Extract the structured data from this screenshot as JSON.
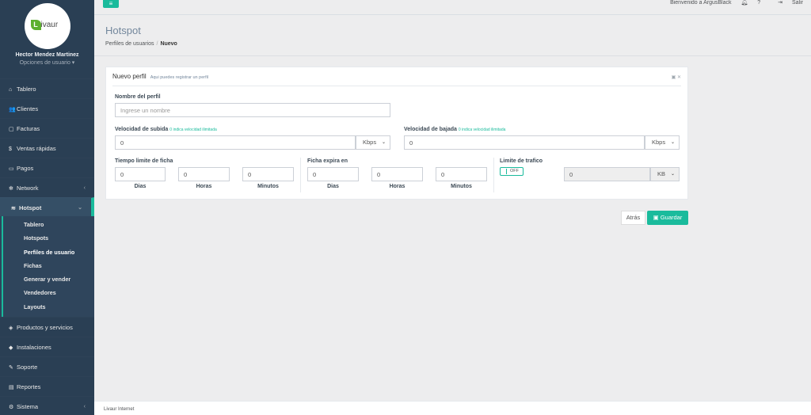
{
  "sidebar": {
    "user_name": "Hector Mendez Martinez",
    "user_options": "Opciones de usuario ▾",
    "logo_letter": "L",
    "logo_text": "ivaur",
    "menu": [
      {
        "label": "Tablero",
        "icon": "home-icon"
      },
      {
        "label": "Clientes",
        "icon": "users-icon"
      },
      {
        "label": "Facturas",
        "icon": "document-icon"
      },
      {
        "label": "Ventas rápidas",
        "icon": "dollar-icon"
      },
      {
        "label": "Pagos",
        "icon": "money-icon"
      },
      {
        "label": "Network",
        "icon": "gear-icon"
      },
      {
        "label": "Hotspot",
        "icon": "wifi-icon"
      },
      {
        "label": "Productos y servicios",
        "icon": "tags-icon"
      },
      {
        "label": "Instalaciones",
        "icon": "tag-icon"
      },
      {
        "label": "Soporte",
        "icon": "wrench-icon"
      },
      {
        "label": "Reportes",
        "icon": "database-icon"
      },
      {
        "label": "Sistema",
        "icon": "cogs-icon"
      }
    ],
    "hotspot_submenu": [
      "Tablero",
      "Hotspots",
      "Perfiles de usuario",
      "Fichas",
      "Generar y vender",
      "Vendedores",
      "Layouts"
    ]
  },
  "topbar": {
    "welcome": "Bienvenido a ArgusBlack",
    "logout": "Salir"
  },
  "page": {
    "title": "Hotspot",
    "breadcrumb_parent": "Perfiles de usuarios",
    "breadcrumb_current": "Nuevo"
  },
  "panel": {
    "title": "Nuevo perfil",
    "subtitle": "Aqui puedes registrar un perfil",
    "profile_name_label": "Nombre del perfil",
    "profile_name_placeholder": "Ingrese un nombre",
    "upload_label": "Velocidad de subida",
    "download_label": "Velocidad de bajada",
    "speed_hint": "0 indica velocidad ilimitada",
    "upload_value": "0",
    "download_value": "0",
    "speed_unit": "Kbps",
    "time_limit_label": "Tiempo limite de ficha",
    "expires_label": "Ficha expira en",
    "traffic_label": "Limite de trafico",
    "days": "Dias",
    "hours": "Horas",
    "minutes": "Minutos",
    "zero": "0",
    "toggle_state": "OFF",
    "traffic_value": "0",
    "traffic_unit": "KB"
  },
  "actions": {
    "back": "Atrás",
    "save": "Guardar"
  },
  "footer": {
    "text": "Livaur Internet"
  },
  "colors": {
    "sidebar": "#2a3f54",
    "accent": "#1abb9c",
    "background": "#ededee"
  }
}
